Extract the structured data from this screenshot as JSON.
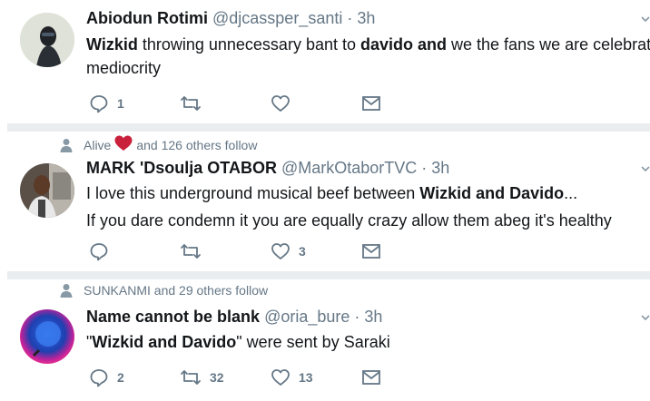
{
  "tweets": [
    {
      "social_context": "",
      "name": "Abiodun Rotimi",
      "handle": "@djcassper_santi",
      "dot": "·",
      "time": "3h",
      "line1": [
        {
          "t": "Wizkid",
          "b": true
        },
        {
          "t": " throwing unnecessary bant to ",
          "b": false
        },
        {
          "t": "davido and",
          "b": true
        },
        {
          "t": " we the fans we  are celebrating",
          "b": false
        }
      ],
      "line2": [
        {
          "t": "mediocrity",
          "b": false
        }
      ],
      "reply_count": "1",
      "retweet_count": "",
      "like_count": ""
    },
    {
      "social_context": "and 126 others follow",
      "social_prefix": "Alive",
      "name": "MARK 'Dsoulja OTABOR",
      "handle": "@MarkOtaborTVC",
      "dot": "·",
      "time": "3h",
      "line1": [
        {
          "t": "I love this underground musical beef between ",
          "b": false
        },
        {
          "t": "Wizkid and Davido",
          "b": true
        },
        {
          "t": "...",
          "b": false
        }
      ],
      "line2": [
        {
          "t": "If you dare condemn it you are equally crazy allow them abeg it's healthy",
          "b": false
        }
      ],
      "reply_count": "",
      "retweet_count": "",
      "like_count": "3"
    },
    {
      "social_context": "SUNKANMI and 29 others follow",
      "name": "Name cannot be blank",
      "handle": "@oria_bure",
      "dot": "·",
      "time": "3h",
      "line1": [
        {
          "t": "\"",
          "b": false
        },
        {
          "t": "Wizkid and Davido",
          "b": true
        },
        {
          "t": "\" were sent by Saraki",
          "b": false
        }
      ],
      "line2": [],
      "reply_count": "2",
      "retweet_count": "32",
      "like_count": "13"
    }
  ],
  "icons": {
    "reply": "reply-icon",
    "retweet": "retweet-icon",
    "like": "heart-icon",
    "dm": "envelope-icon",
    "person": "person-icon",
    "heart_emoji": "red-heart-emoji",
    "caret": "chevron-down-icon"
  },
  "colors": {
    "text": "#14171a",
    "muted": "#657786",
    "separator": "#e9edf0",
    "heart_emoji": "#e0245e"
  }
}
